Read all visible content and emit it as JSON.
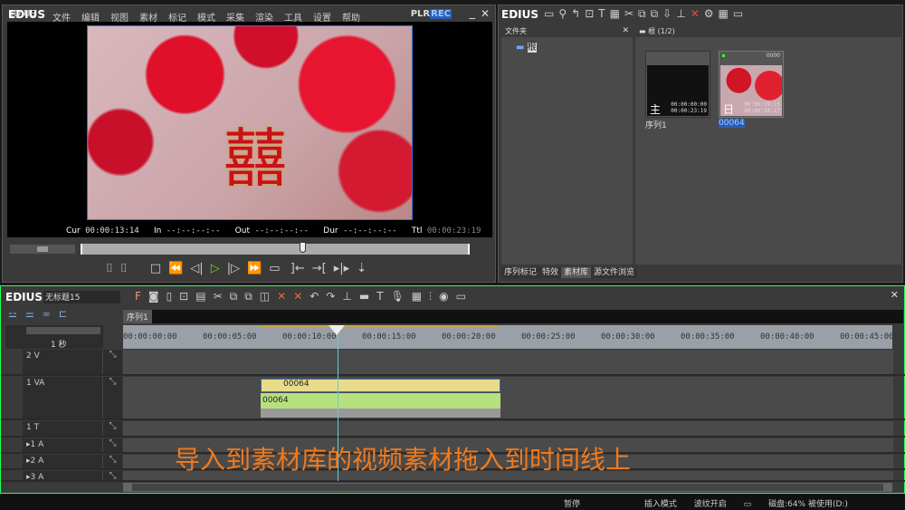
{
  "player": {
    "app": "EDIUS",
    "menu": [
      "文件",
      "编辑",
      "视图",
      "素材",
      "标记",
      "模式",
      "采集",
      "渲染",
      "工具",
      "设置",
      "帮助"
    ],
    "plr": "PLR",
    "rec": "REC",
    "cur_label": "Cur",
    "cur": "00:00:13:14",
    "in_label": "In",
    "in": "--:--:--:--",
    "out_label": "Out",
    "out": "--:--:--:--",
    "dur_label": "Dur",
    "dur": "--:--:--:--",
    "ttl_label": "Ttl",
    "ttl": "00:00:23:19",
    "scrub_position": 0.57
  },
  "bin": {
    "app": "EDIUS",
    "folder_header": "文件夹",
    "root": "根",
    "bin_header": "根 (1/2)",
    "clips": [
      {
        "name": "序列1",
        "tc1": "00:00:00:00",
        "tc2": "00:00:23:19",
        "icon": "主"
      },
      {
        "name": "00064",
        "tc1": "00:06:19:15",
        "tc2": "00:06:34:17",
        "icon": "日",
        "tag": "0000"
      }
    ],
    "tabs": [
      "序列标记",
      "特效",
      "素材库",
      "源文件浏览"
    ]
  },
  "timeline": {
    "app": "EDIUS",
    "project": "无标题15",
    "sequence_tab": "序列1",
    "scale": "1 秒",
    "ruler": [
      "00:00:00:00",
      "00:00:05:00",
      "00:00:10:00",
      "00:00:15:00",
      "00:00:20:00",
      "00:00:25:00",
      "00:00:30:00",
      "00:00:35:00",
      "00:00:40:00",
      "00:00:45:00"
    ],
    "tracks": [
      {
        "name": "2 V"
      },
      {
        "name": "1 VA"
      },
      {
        "name": "1 T"
      },
      {
        "name": "▸1 A"
      },
      {
        "name": "▸2 A"
      },
      {
        "name": "▸3 A"
      }
    ],
    "clip_video": "00064",
    "clip_audio": "00064",
    "subtitle": "导入到素材库的视频素材拖入到时间线上"
  },
  "status": {
    "pause": "暂停",
    "mode": "插入模式",
    "ripple": "波纹开启",
    "disk": "磁盘:64% 被使用(D:)"
  }
}
